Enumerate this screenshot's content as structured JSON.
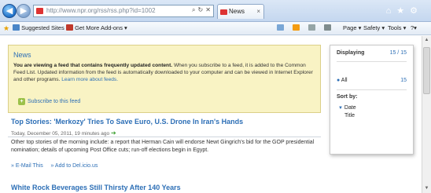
{
  "browser": {
    "address": "http://www.npr.org/rss/rss.php?id=1002",
    "tab_title": "News",
    "tab_close": "×"
  },
  "command_bar": {
    "suggested_sites": "Suggested Sites ▾",
    "get_more_addons": "Get More Add-ons ▾",
    "page_menu": "Page ▾",
    "safety_menu": "Safety ▾",
    "tools_menu": "Tools ▾",
    "help_menu": "?▾"
  },
  "info_box": {
    "heading": "News",
    "bold_text": "You are viewing a feed that contains frequently updated content.",
    "body_text": " When you subscribe to a feed, it is added to the Common Feed List. Updated information from the feed is automatically downloaded to your computer and can be viewed in Internet Explorer and other programs. ",
    "learn_more": "Learn more about feeds.",
    "subscribe": "Subscribe to this feed"
  },
  "side_panel": {
    "displaying_label": "Displaying",
    "displaying_count": "15 / 15",
    "all_label": "All",
    "all_count": "15",
    "sort_label": "Sort by:",
    "sort_date": "Date",
    "sort_title": "Title"
  },
  "stories": [
    {
      "title": "Top Stories: 'Merkozy' Tries To Save Euro, U.S. Drone In Iran's Hands",
      "meta": "Today, December 05, 2011, 19 minutes ago",
      "body": "Other top stories of the morning include: a report that Herman Cain will endorse Newt Gingrich's bid for the GOP presidential nomination; details of upcoming Post Office cuts; run-off elections begin in Egypt.",
      "email_link": "» E-Mail This",
      "delicious_link": "» Add to Del.icio.us"
    },
    {
      "title": "White Rock Beverages Still Thirsty After 140 Years"
    }
  ],
  "colors": {
    "link_blue": "#2d6fb6",
    "infobox_bg": "#f9f3c4"
  }
}
